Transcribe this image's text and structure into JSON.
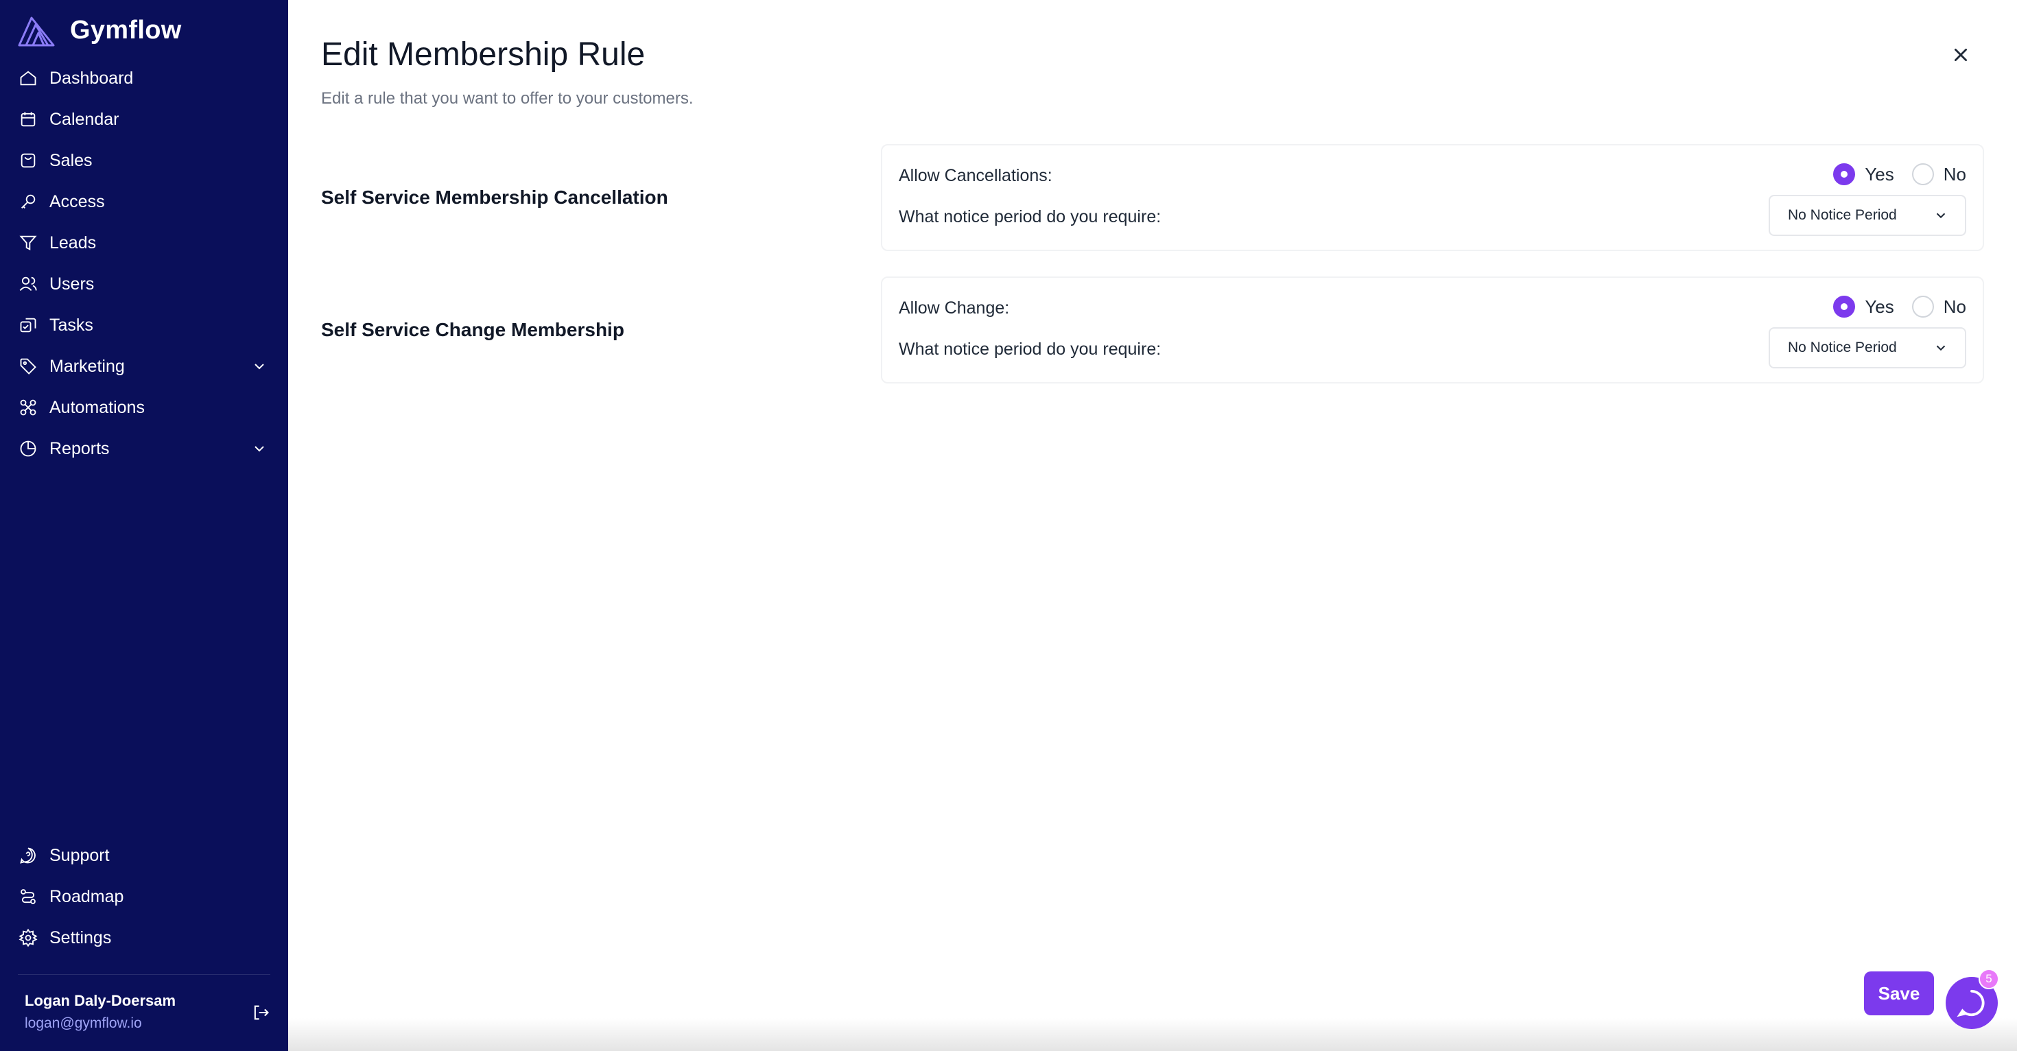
{
  "brand": {
    "name": "Gymflow",
    "accent": "#7c3aed",
    "sidebar_bg": "#0a0f5a"
  },
  "nav": {
    "items": [
      {
        "label": "Dashboard",
        "icon": "home-icon"
      },
      {
        "label": "Calendar",
        "icon": "calendar-icon"
      },
      {
        "label": "Sales",
        "icon": "bag-icon"
      },
      {
        "label": "Access",
        "icon": "key-icon"
      },
      {
        "label": "Leads",
        "icon": "funnel-icon"
      },
      {
        "label": "Users",
        "icon": "users-icon"
      },
      {
        "label": "Tasks",
        "icon": "tasks-icon"
      },
      {
        "label": "Marketing",
        "icon": "tag-icon",
        "expandable": true
      },
      {
        "label": "Automations",
        "icon": "automation-icon"
      },
      {
        "label": "Reports",
        "icon": "pie-chart-icon",
        "expandable": true
      }
    ],
    "bottom": [
      {
        "label": "Support",
        "icon": "support-icon"
      },
      {
        "label": "Roadmap",
        "icon": "route-icon"
      },
      {
        "label": "Settings",
        "icon": "gear-icon"
      }
    ]
  },
  "user": {
    "name": "Logan Daly-Doersam",
    "email": "logan@gymflow.io"
  },
  "page": {
    "title": "Edit Membership Rule",
    "subtitle": "Edit a rule that you want to offer to your customers."
  },
  "sections": [
    {
      "label": "Self Service Membership Cancellation",
      "allow_label": "Allow Cancellations:",
      "yes_label": "Yes",
      "no_label": "No",
      "selected": "Yes",
      "notice_label": "What notice period do you require:",
      "notice_value": "No Notice Period"
    },
    {
      "label": "Self Service Change Membership",
      "allow_label": "Allow Change:",
      "yes_label": "Yes",
      "no_label": "No",
      "selected": "Yes",
      "notice_label": "What notice period do you require:",
      "notice_value": "No Notice Period"
    }
  ],
  "actions": {
    "save_label": "Save",
    "chat_badge": "5"
  }
}
